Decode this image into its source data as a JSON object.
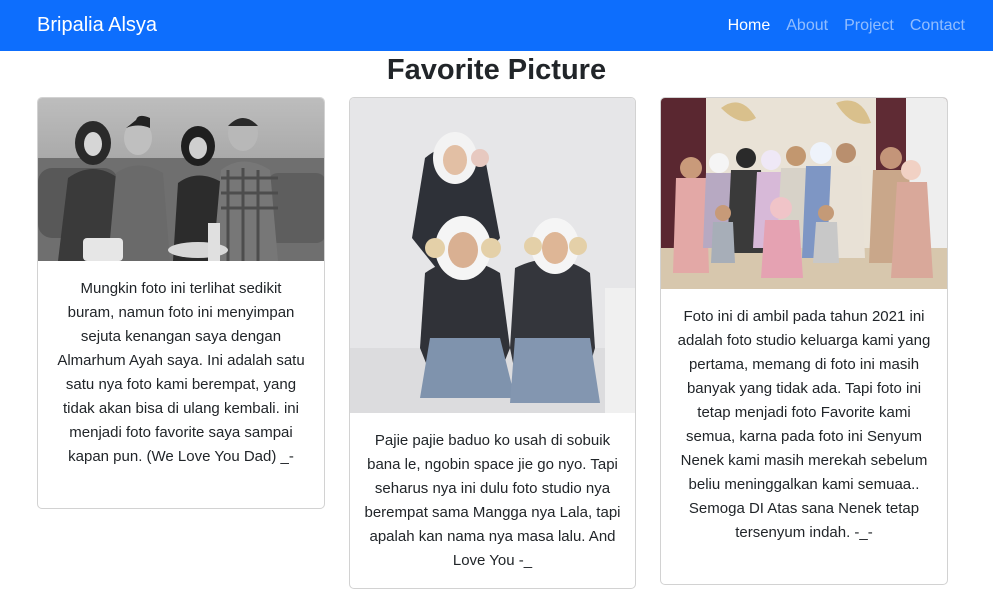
{
  "navbar": {
    "brand": "Bripalia Alsya",
    "links": [
      "Home",
      "About",
      "Project",
      "Contact"
    ],
    "active": "Home"
  },
  "page_title": "Favorite Picture",
  "cards": [
    {
      "image": "family-photo-grayscale",
      "text": "Mungkin foto ini terlihat sedikit buram, namun foto ini menyimpan sejuta kenangan saya dengan Almarhum Ayah saya. Ini adalah satu satu nya foto kami berempat, yang tidak akan bisa di ulang kembali. ini menjadi foto favorite saya sampai kapan pun. (We Love You Dad) _-"
    },
    {
      "image": "friends-studio-photo",
      "text": "Pajie pajie baduo ko usah di sobuik bana le, ngobin space jie go nyo. Tapi seharus nya ini dulu foto studio nya berempat sama Mangga nya Lala, tapi apalah kan nama nya masa lalu. And Love You -_"
    },
    {
      "image": "big-family-studio-photo",
      "text": "Foto ini di ambil pada tahun 2021 ini adalah foto studio keluarga kami yang pertama, memang di foto ini masih banyak yang tidak ada. Tapi foto ini tetap menjadi foto Favorite kami semua, karna pada foto ini Senyum Nenek kami masih merekah sebelum beliu meninggalkan kami semuaa.. Semoga DI Atas sana Nenek tetap tersenyum indah. -_-"
    }
  ]
}
